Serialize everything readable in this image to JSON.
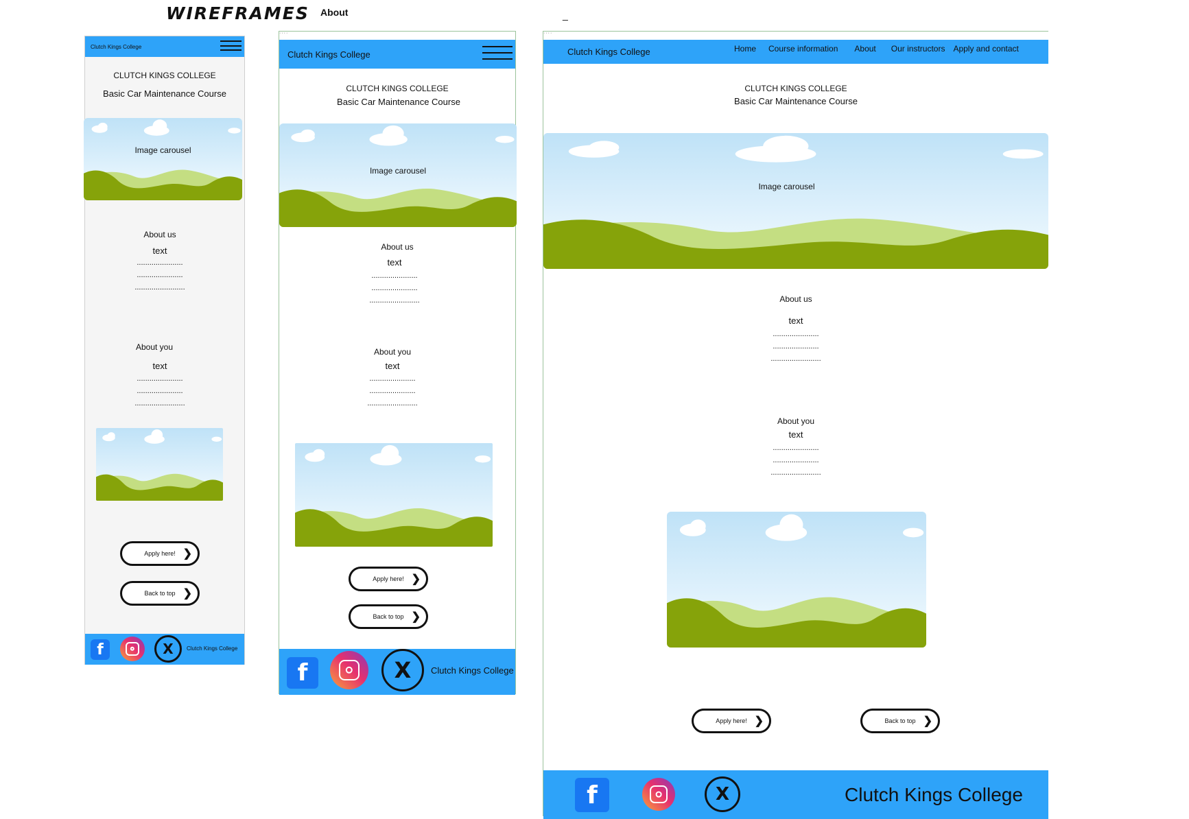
{
  "header": {
    "title": "WIREFRAMES",
    "subtitle": "About",
    "dash": "_"
  },
  "site": {
    "brand": "Clutch Kings College",
    "heading": "CLUTCH KINGS COLLEGE",
    "course": "Basic Car Maintenance Course",
    "carousel_label": "Image carousel",
    "about_us": "About us",
    "about_you": "About you",
    "text": "text",
    "dots_a": "......................",
    "dots_b": "........................",
    "apply": "Apply here!",
    "back": "Back to top",
    "footer_brand": "Clutch Kings College",
    "fb_glyph": "f",
    "x_glyph": "X"
  },
  "nav": {
    "home": "Home",
    "course": "Course information",
    "about": "About",
    "instructors": "Our instructors",
    "apply": "Apply and contact"
  },
  "icons": [
    "hamburger-menu-icon",
    "facebook-icon",
    "instagram-icon",
    "x-twitter-icon",
    "chevron-right-icon"
  ],
  "colors": {
    "nav_blue": "#2ea3f9",
    "hill_dark": "#86a30a",
    "hill_light": "#c4de82",
    "sky_top": "#bfe2f7",
    "facebook": "#1877f2"
  }
}
